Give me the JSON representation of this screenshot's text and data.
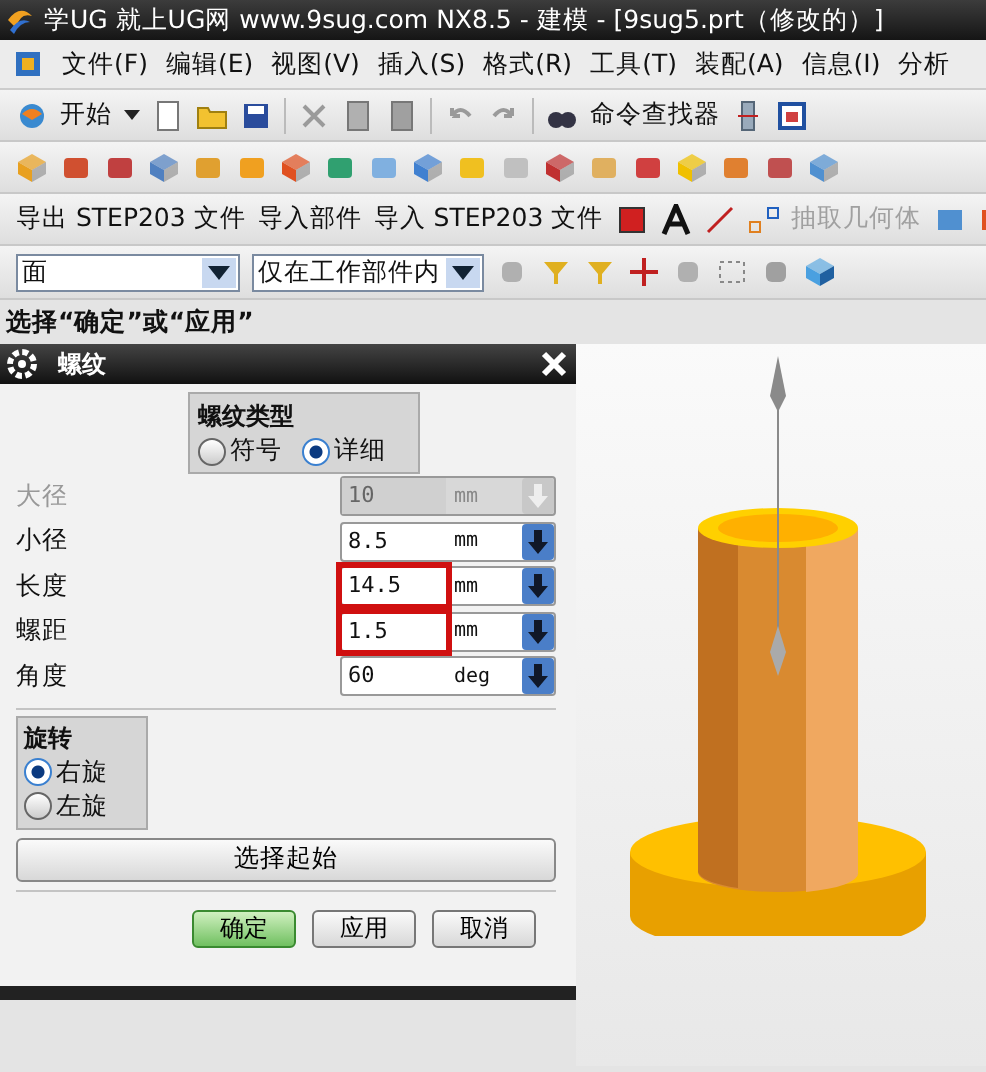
{
  "window": {
    "title": "学UG 就上UG网  www.9sug.com NX8.5 - 建模 - [9sug5.prt（修改的）]"
  },
  "menu": [
    "文件(F)",
    "编辑(E)",
    "视图(V)",
    "插入(S)",
    "格式(R)",
    "工具(T)",
    "装配(A)",
    "信息(I)",
    "分析"
  ],
  "standard_toolbar": {
    "start": "开始",
    "command_finder": "命令查找器"
  },
  "text_toolbar": [
    {
      "label": "导出 STEP203 文件",
      "disabled": false
    },
    {
      "label": "导入部件",
      "disabled": false
    },
    {
      "label": "导入 STEP203 文件",
      "disabled": false
    },
    {
      "label": "抽取几何体",
      "disabled": true
    }
  ],
  "selection_bar": {
    "type_filter": "面",
    "scope": "仅在工作部件内"
  },
  "prompt": "选择“确定”或“应用”",
  "dialog": {
    "title": "螺纹",
    "thread_type": {
      "label": "螺纹类型",
      "options": [
        {
          "label": "符号",
          "selected": false
        },
        {
          "label": "详细",
          "selected": true
        }
      ]
    },
    "fields": [
      {
        "label": "大径",
        "value": "10",
        "unit": "mm",
        "disabled": true,
        "highlighted": false
      },
      {
        "label": "小径",
        "value": "8.5",
        "unit": "mm",
        "disabled": false,
        "highlighted": false
      },
      {
        "label": "长度",
        "value": "14.5",
        "unit": "mm",
        "disabled": false,
        "highlighted": true
      },
      {
        "label": "螺距",
        "value": "1.5",
        "unit": "mm",
        "disabled": false,
        "highlighted": true
      },
      {
        "label": "角度",
        "value": "60",
        "unit": "deg",
        "disabled": false,
        "highlighted": false
      }
    ],
    "rotation": {
      "label": "旋转",
      "options": [
        {
          "label": "右旋",
          "selected": true
        },
        {
          "label": "左旋",
          "selected": false
        }
      ]
    },
    "select_start": "选择起始",
    "buttons": [
      {
        "label": "确定",
        "kind": "primary"
      },
      {
        "label": "应用",
        "kind": "normal"
      },
      {
        "label": "取消",
        "kind": "normal"
      }
    ]
  }
}
